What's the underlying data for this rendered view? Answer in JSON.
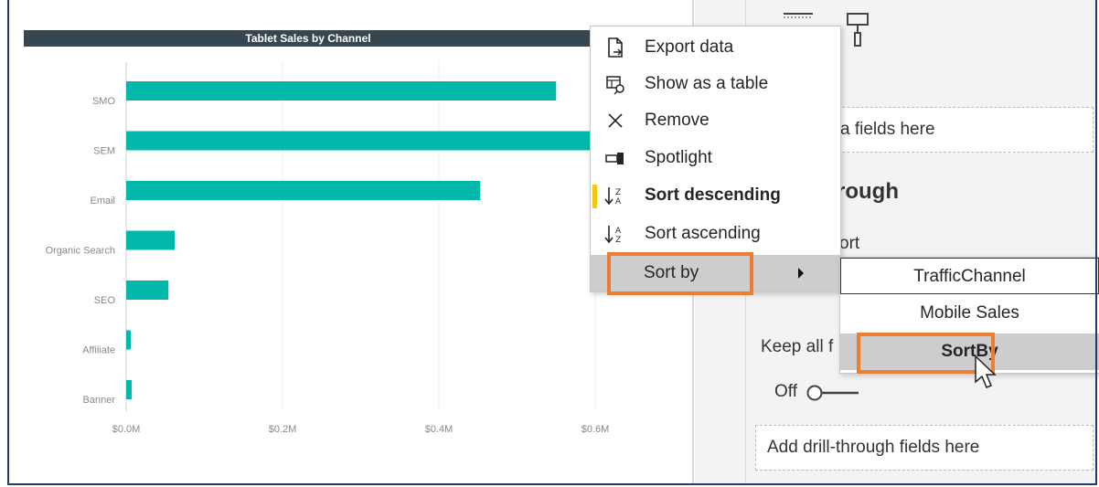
{
  "chart": {
    "title": "Tablet Sales by Channel",
    "bar_color": "#01b8aa"
  },
  "chart_data": {
    "type": "bar",
    "orientation": "horizontal",
    "title": "Tablet Sales by Channel",
    "categories": [
      "SMO",
      "SEM",
      "Email",
      "Organic Search",
      "SEO",
      "Affiliate",
      "Banner"
    ],
    "values": [
      0.55,
      0.62,
      0.453,
      0.062,
      0.054,
      0.006,
      0.007
    ],
    "x_tick_labels": [
      "$0.0M",
      "$0.2M",
      "$0.4M",
      "$0.6M"
    ],
    "xlim": [
      0,
      0.6
    ],
    "grid": true,
    "unit": "$M"
  },
  "context_menu": {
    "items": [
      {
        "label": "Export data",
        "icon": "export-icon"
      },
      {
        "label": "Show as a table",
        "icon": "table-icon"
      },
      {
        "label": "Remove",
        "icon": "close-icon"
      },
      {
        "label": "Spotlight",
        "icon": "spotlight-icon"
      },
      {
        "label": "Sort descending",
        "icon": "sort-descending-icon"
      },
      {
        "label": "Sort ascending",
        "icon": "sort-ascending-icon"
      },
      {
        "label": "Sort by",
        "icon": "chevron-right-icon"
      }
    ]
  },
  "submenu": {
    "items": [
      "TrafficChannel",
      "Mobile Sales",
      "SortBy"
    ]
  },
  "right_pane": {
    "fields_here_fragment": "a fields here",
    "drillthrough_fragment": "rough",
    "report_fragment": "ort",
    "keep_all_fragment": "Keep all f",
    "toggle_label": "Off",
    "drill_fields_placeholder": "Add drill-through fields here"
  },
  "colors": {
    "accent_orange": "#ed7d31",
    "highlight_yellow": "#f2c811"
  }
}
